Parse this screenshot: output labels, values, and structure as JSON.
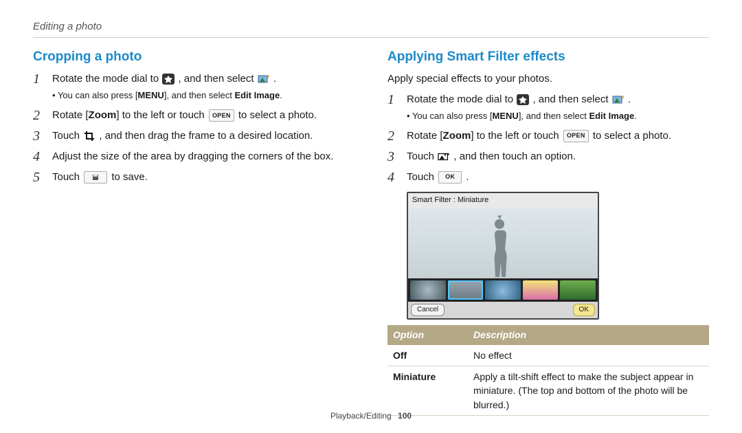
{
  "header": {
    "breadcrumb": "Editing a photo"
  },
  "left": {
    "title": "Cropping a photo",
    "steps": {
      "s1_a": "Rotate the mode dial to ",
      "s1_b": ", and then select ",
      "s1_c": ".",
      "s1_note_a": "You can also press [",
      "s1_note_menu": "MENU",
      "s1_note_b": "], and then select ",
      "s1_note_bold": "Edit Image",
      "s1_note_c": ".",
      "s2_a": "Rotate [",
      "s2_zoom": "Zoom",
      "s2_b": "] to the left or touch ",
      "s2_open": "OPEN",
      "s2_c": " to select a photo.",
      "s3_a": "Touch ",
      "s3_b": ", and then drag the frame to a desired location.",
      "s4": "Adjust the size of the area by dragging the corners of the box.",
      "s5_a": "Touch ",
      "s5_b": " to save."
    }
  },
  "right": {
    "title": "Applying Smart Filter effects",
    "intro": "Apply special effects to your photos.",
    "steps": {
      "s1_a": "Rotate the mode dial to ",
      "s1_b": ", and then select ",
      "s1_c": ".",
      "s1_note_a": "You can also press [",
      "s1_note_menu": "MENU",
      "s1_note_b": "], and then select ",
      "s1_note_bold": "Edit Image",
      "s1_note_c": ".",
      "s2_a": "Rotate [",
      "s2_zoom": "Zoom",
      "s2_b": "] to the left or touch ",
      "s2_open": "OPEN",
      "s2_c": " to select a photo.",
      "s3_a": "Touch ",
      "s3_b": ", and then touch an option.",
      "s4_a": "Touch ",
      "s4_ok": "OK",
      "s4_b": "."
    },
    "preview": {
      "label": "Smart Filter : Miniature",
      "cancel": "Cancel",
      "ok": "OK"
    },
    "table": {
      "h_option": "Option",
      "h_desc": "Description",
      "rows": [
        {
          "name": "Off",
          "desc": "No effect"
        },
        {
          "name": "Miniature",
          "desc": "Apply a tilt-shift effect to make the subject appear in miniature. (The top and bottom of the photo will be blurred.)"
        }
      ]
    }
  },
  "footer": {
    "section": "Playback/Editing",
    "page": "100"
  }
}
